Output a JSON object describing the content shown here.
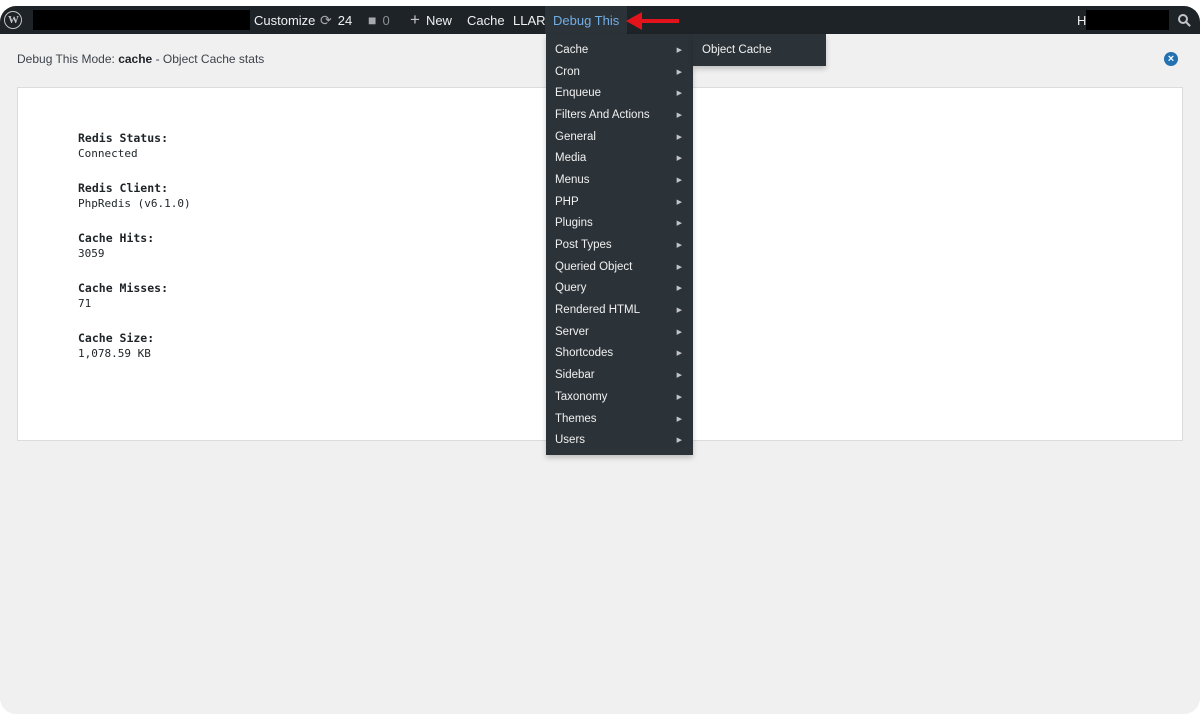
{
  "adminbar": {
    "customize": "Customize",
    "updates_count": "24",
    "comments_count": "0",
    "new_label": "New",
    "cache_label": "Cache",
    "llar_label": "LLAR",
    "debug_label": "Debug This",
    "howdy_prefix": "H"
  },
  "page": {
    "mode_prefix": "Debug This Mode:",
    "mode_name": "cache",
    "mode_suffix": "- Object Cache stats",
    "close_glyph": "×"
  },
  "stats": [
    {
      "label": "Redis Status:",
      "value": "Connected"
    },
    {
      "label": "Redis Client:",
      "value": "PhpRedis (v6.1.0)"
    },
    {
      "label": "Cache Hits:",
      "value": "3059"
    },
    {
      "label": "Cache Misses:",
      "value": "71"
    },
    {
      "label": "Cache Size:",
      "value": "1,078.59 KB"
    }
  ],
  "menu": [
    "Cache",
    "Cron",
    "Enqueue",
    "Filters And Actions",
    "General",
    "Media",
    "Menus",
    "PHP",
    "Plugins",
    "Post Types",
    "Queried Object",
    "Query",
    "Rendered HTML",
    "Server",
    "Shortcodes",
    "Sidebar",
    "Taxonomy",
    "Themes",
    "Users"
  ],
  "submenu": [
    "Object Cache"
  ],
  "colors": {
    "adminbar_bg": "#1d2327",
    "menu_bg": "#2c3338",
    "active_link": "#72aee6",
    "annotation_arrow": "#e3131b",
    "close_button": "#2271b1"
  }
}
